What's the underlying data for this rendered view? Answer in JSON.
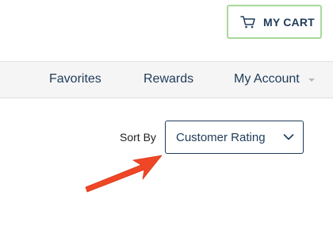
{
  "header": {
    "cart": {
      "label": "MY CART",
      "icon": "cart-icon",
      "border_color": "#a7d99b"
    }
  },
  "nav": {
    "items": [
      {
        "label": "Favorites"
      },
      {
        "label": "Rewards"
      },
      {
        "label": "My Account",
        "has_dropdown": true
      }
    ]
  },
  "sort": {
    "label": "Sort By",
    "selected": "Customer Rating",
    "icon": "chevron-down-icon"
  },
  "annotation": {
    "type": "arrow",
    "color": "#ef4626",
    "points_to": "sort-dropdown"
  },
  "colors": {
    "text_primary": "#1f3b5a",
    "nav_background": "#f5f5f5"
  }
}
